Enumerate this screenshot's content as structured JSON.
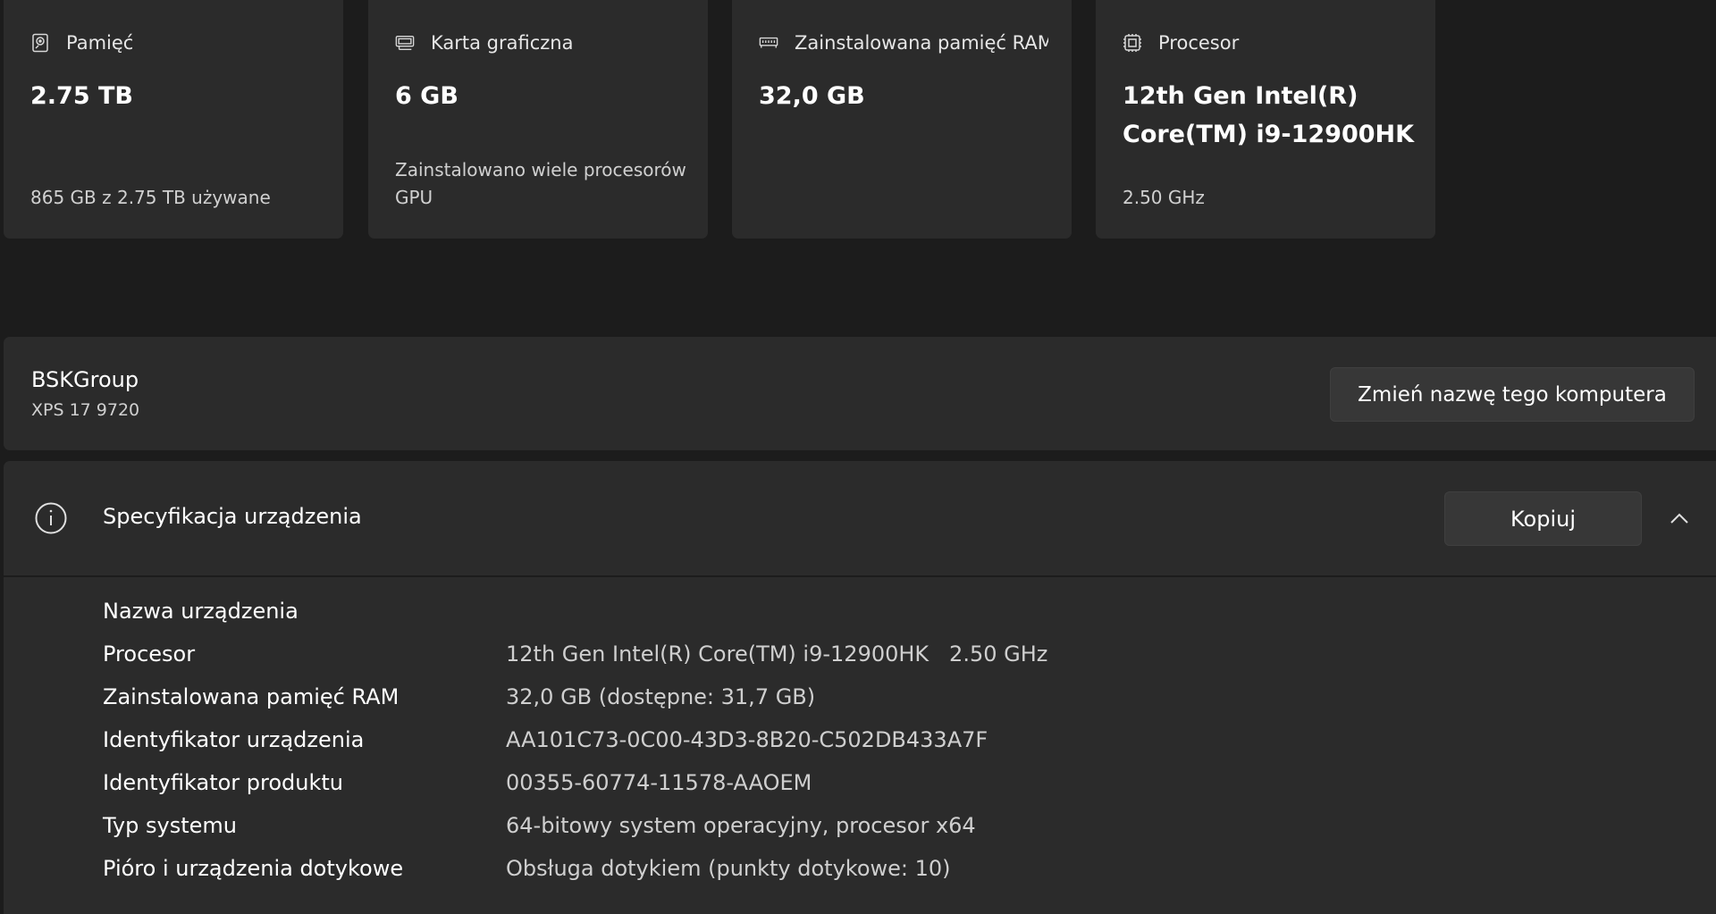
{
  "cards": [
    {
      "icon": "hard-drive-icon",
      "title": "Pamięć",
      "value": "2.75 TB",
      "sub": "865 GB z 2.75 TB używane"
    },
    {
      "icon": "graphics-card-icon",
      "title": "Karta graficzna",
      "value": "6 GB",
      "sub": "Zainstalowano wiele procesorów GPU"
    },
    {
      "icon": "ram-icon",
      "title": "Zainstalowana pamięć RAM",
      "value": "32,0 GB",
      "sub": ""
    },
    {
      "icon": "processor-icon",
      "title": "Procesor",
      "value": "12th Gen Intel(R) Core(TM) i9-12900HK",
      "sub": "2.50 GHz"
    }
  ],
  "device": {
    "name": "BSKGroup",
    "model": "XPS 17 9720",
    "rename_label": "Zmień nazwę tego komputera"
  },
  "spec": {
    "icon": "info-icon",
    "title": "Specyfikacja urządzenia",
    "copy_label": "Kopiuj",
    "collapse_icon": "chevron-up-icon",
    "rows": [
      {
        "label": "Nazwa urządzenia",
        "value": ""
      },
      {
        "label": "Procesor",
        "value": "12th Gen Intel(R) Core(TM) i9-12900HK   2.50 GHz"
      },
      {
        "label": "Zainstalowana pamięć RAM",
        "value": "32,0 GB (dostępne: 31,7 GB)"
      },
      {
        "label": "Identyfikator urządzenia",
        "value": "AA101C73-0C00-43D3-8B20-C502DB433A7F"
      },
      {
        "label": "Identyfikator produktu",
        "value": "00355-60774-11578-AAOEM"
      },
      {
        "label": "Typ systemu",
        "value": "64-bitowy system operacyjny, procesor x64"
      },
      {
        "label": "Pióro i urządzenia dotykowe",
        "value": "Obsługa dotykiem (punkty dotykowe: 10)"
      }
    ]
  },
  "colors": {
    "background": "#1c1c1c",
    "card": "#2b2b2b",
    "button": "#373737",
    "text": "#ffffff",
    "secondary_text": "#cfcfcf"
  }
}
